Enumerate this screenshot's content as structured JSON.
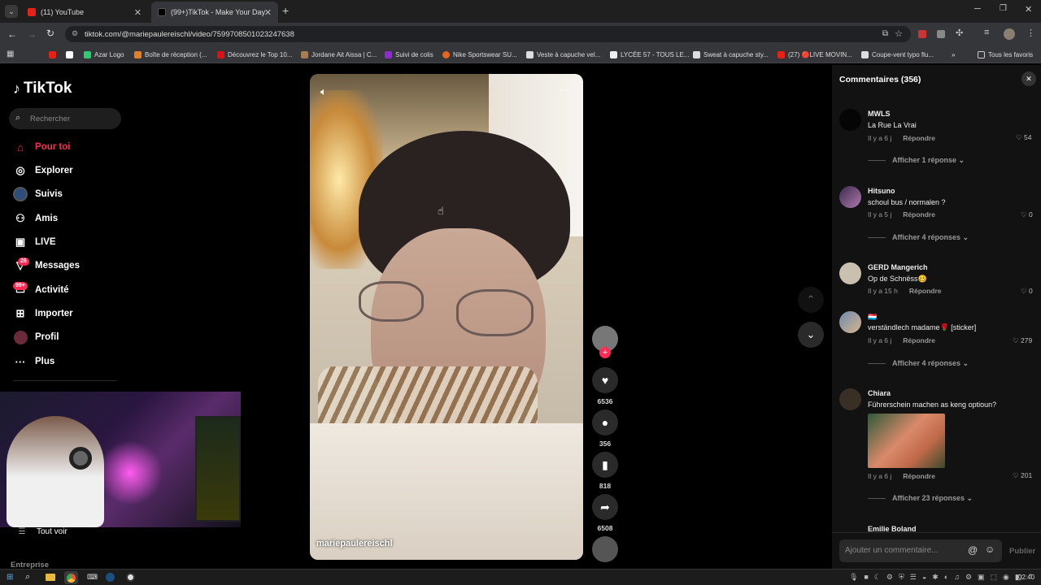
{
  "browser": {
    "tabs": [
      {
        "title": "(11) YouTube"
      },
      {
        "title": "(99+)TikTok - Make Your Day"
      }
    ],
    "url": "tiktok.com/@mariepaulereischl/video/7599708501023247638",
    "bookmarks": [
      "Azar Logo",
      "Boîte de réception (...",
      "Découvrez le Top 10...",
      "Jordane Ait Aissa | C...",
      "Suivi de colis",
      "Nike Sportswear SU...",
      "Veste à capuche vel...",
      "LYCÉE 57 - TOUS LE...",
      "Sweat à capuche sty...",
      "(27) 🔴LIVE MOVIN...",
      "Coupe-vent typo flu..."
    ],
    "all_favorites": "Tous les favoris"
  },
  "sidebar": {
    "logo": "TikTok",
    "search_placeholder": "Rechercher",
    "items": [
      {
        "label": "Pour toi"
      },
      {
        "label": "Explorer"
      },
      {
        "label": "Suivis"
      },
      {
        "label": "Amis"
      },
      {
        "label": "LIVE"
      },
      {
        "label": "Messages",
        "badge": "26"
      },
      {
        "label": "Activité",
        "badge": "99+"
      },
      {
        "label": "Importer"
      },
      {
        "label": "Profil"
      },
      {
        "label": "Plus"
      }
    ],
    "see_all": "Tout voir",
    "company": "Entreprise"
  },
  "video": {
    "author": "mariepaulereischl",
    "likes": "6536",
    "comments": "356",
    "saves": "818",
    "shares": "6508"
  },
  "comments": {
    "title": "Commentaires",
    "count": "(356)",
    "reply_label": "Répondre",
    "items": [
      {
        "user": "MWLS",
        "text": "La Rue La Vrai",
        "time": "Il y a 6 j",
        "likes": "54",
        "more": "Afficher 1 réponse"
      },
      {
        "user": "Hitsuno",
        "text": "schoul bus / normalen ?",
        "time": "Il y a 5 j",
        "likes": "0",
        "more": "Afficher 4 réponses"
      },
      {
        "user": "GERD Mangerich",
        "text": "Op de Schnëss🥴",
        "time": "Il y a 15 h",
        "likes": "0",
        "more": ""
      },
      {
        "user": "🇱🇺",
        "text": "verständlech madame🌹 [sticker]",
        "time": "Il y a 6 j",
        "likes": "279",
        "more": "Afficher 4 réponses"
      },
      {
        "user": "Chiara",
        "text": "Führerschein machen as keng optioun?",
        "time": "Il y a 6 j",
        "likes": "201",
        "more": "Afficher 23 réponses"
      },
      {
        "user": "Emilie Boland",
        "text": "",
        "time": "",
        "likes": "",
        "more": ""
      }
    ],
    "input_placeholder": "Ajouter un commentaire...",
    "publish": "Publier"
  },
  "taskbar": {
    "time": "02:40"
  }
}
